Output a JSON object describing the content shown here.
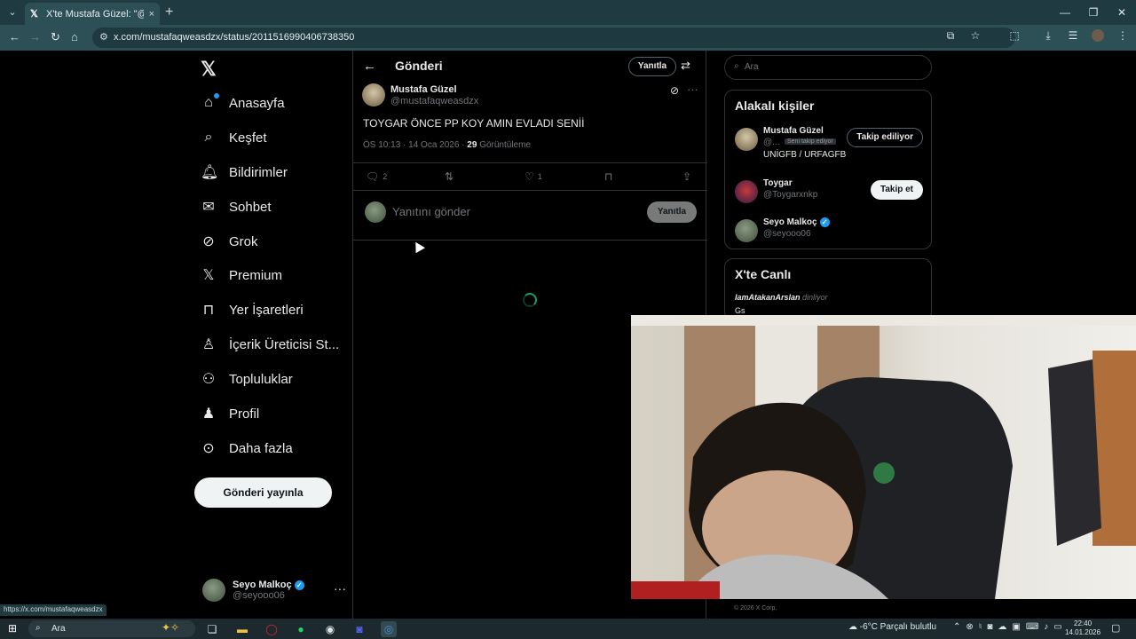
{
  "browser": {
    "tab_title": "X'te Mustafa Güzel: \"@Toygarxnkp...",
    "tab_close": "×",
    "new_tab": "+",
    "url": "x.com/mustafaqweasdzx/status/2011516990406738350",
    "status_url": "https://x.com/mustafaqweasdzx"
  },
  "nav": {
    "items": [
      {
        "label": "Anasayfa",
        "icon": "home-icon"
      },
      {
        "label": "Keşfet",
        "icon": "search-icon"
      },
      {
        "label": "Bildirimler",
        "icon": "bell-icon"
      },
      {
        "label": "Sohbet",
        "icon": "mail-icon"
      },
      {
        "label": "Grok",
        "icon": "grok-icon"
      },
      {
        "label": "Premium",
        "icon": "x-icon"
      },
      {
        "label": "Yer İşaretleri",
        "icon": "bookmark-icon"
      },
      {
        "label": "İçerik Üreticisi St...",
        "icon": "creator-icon"
      },
      {
        "label": "Topluluklar",
        "icon": "community-icon"
      },
      {
        "label": "Profil",
        "icon": "profile-icon"
      },
      {
        "label": "Daha fazla",
        "icon": "more-icon"
      }
    ],
    "post_button": "Gönderi yayınla",
    "me": {
      "name": "Seyo Malkoç",
      "handle": "@seyooo06"
    }
  },
  "center": {
    "title": "Gönderi",
    "reply_pill": "Yanıtla",
    "tweet": {
      "name": "Mustafa Güzel",
      "handle": "@mustafaqweasdzx",
      "text": "TOYGAR ÖNCE PP KOY AMIN EVLADI SENİİ",
      "time": "ÖS 10:13 · 14 Oca 2026 · ",
      "views_count": "29",
      "views_label": " Görüntüleme",
      "replies": "2",
      "likes": "1"
    },
    "compose": {
      "placeholder": "Yanıtını gönder",
      "button": "Yanıtla"
    }
  },
  "right": {
    "search_placeholder": "Ara",
    "related_title": "Alakalı kişiler",
    "people": [
      {
        "name": "Mustafa Güzel",
        "handle": "@...",
        "badge": "Seni takip ediyor",
        "bio": "UNİGFB / URFAGFB",
        "button": "Takip ediliyor"
      },
      {
        "name": "Toygar",
        "handle": "@Toygarxnkp",
        "button": "Takip et"
      },
      {
        "name": "Seyo Malkoç",
        "handle": "@seyooo06"
      }
    ],
    "live_title": "X'te Canlı",
    "live_user": "IamAtakanArslan",
    "live_suffix": " dinliyor",
    "live_line2": "Gs",
    "footer": "© 2026 X Corp."
  },
  "taskbar": {
    "search_label": "Ara",
    "weather": "-6°C  Parçalı bulutlu",
    "time": "22:40",
    "date": "14.01.2026"
  }
}
